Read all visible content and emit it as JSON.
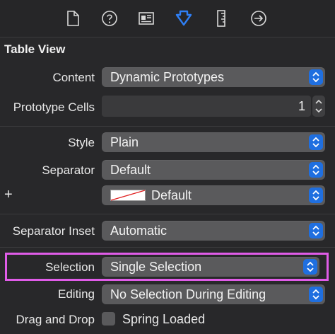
{
  "section": {
    "title": "Table View"
  },
  "toolbar": {
    "icons": [
      "file-icon",
      "help-icon",
      "identity-icon",
      "attributes-icon",
      "ruler-icon",
      "connections-icon"
    ],
    "active": "attributes-icon",
    "accent": "#2f7ff5"
  },
  "rows": {
    "content": {
      "label": "Content",
      "value": "Dynamic Prototypes"
    },
    "prototype_cells": {
      "label": "Prototype Cells",
      "value": "1"
    },
    "style": {
      "label": "Style",
      "value": "Plain"
    },
    "separator": {
      "label": "Separator",
      "value": "Default"
    },
    "separator_color": {
      "label": "+",
      "value": "Default"
    },
    "separator_inset": {
      "label": "Separator Inset",
      "value": "Automatic"
    },
    "selection": {
      "label": "Selection",
      "value": "Single Selection"
    },
    "editing": {
      "label": "Editing",
      "value": "No Selection During Editing"
    },
    "drag_and_drop": {
      "label": "Drag and Drop",
      "checkbox_label": "Spring Loaded"
    }
  },
  "colors": {
    "highlight": "#e05ce8",
    "popup_button": "#1f6fe0"
  }
}
